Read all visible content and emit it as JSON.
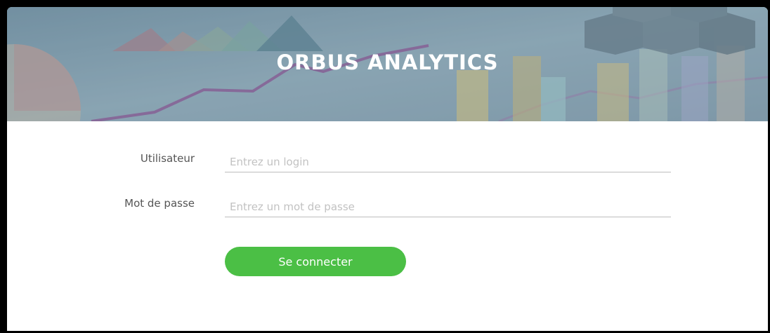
{
  "header": {
    "title": "ORBUS ANALYTICS"
  },
  "form": {
    "user_label": "Utilisateur",
    "user_placeholder": "Entrez un login",
    "user_value": "",
    "password_label": "Mot de passe",
    "password_placeholder": "Entrez un mot de passe",
    "password_value": "",
    "submit_label": "Se connecter"
  },
  "colors": {
    "banner": "#7a96a6",
    "button": "#4bbf45",
    "page_frame": "#000000"
  }
}
